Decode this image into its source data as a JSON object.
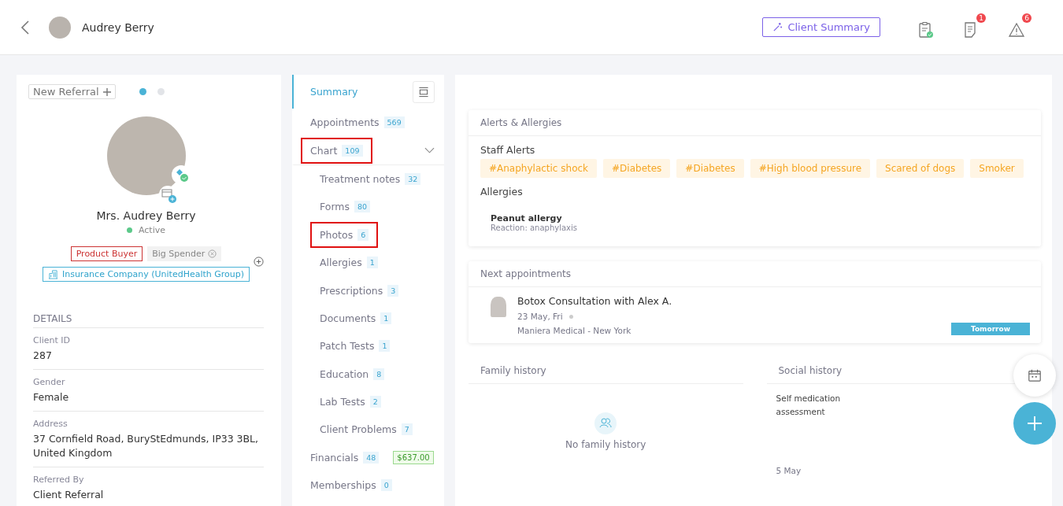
{
  "header": {
    "client_name": "Audrey Berry",
    "summary_button": "Client Summary",
    "notifications": [
      {
        "kind": "clipboard"
      },
      {
        "kind": "notes",
        "badge": "1"
      },
      {
        "kind": "alert",
        "badge": "6"
      }
    ]
  },
  "profile": {
    "referral_button": "New Referral",
    "dots": [
      {
        "selected": true
      },
      {
        "selected": false
      }
    ],
    "name": "Mrs. Audrey Berry",
    "status": "Active",
    "active": true,
    "tags": [
      {
        "label": "Product Buyer",
        "kind": "outlined"
      },
      {
        "label": "Big Spender",
        "kind": "removable"
      }
    ],
    "insurance": "Insurance Company (UnitedHealth Group)",
    "details_title": "DETAILS",
    "details": [
      {
        "label": "Client ID",
        "value": "287"
      },
      {
        "label": "Gender",
        "value": "Female"
      },
      {
        "label": "Address",
        "value": "37 Cornfield Road, BuryStEdmunds, IP33 3BL, United Kingdom"
      },
      {
        "label": "Referred By",
        "value": "Client Referral"
      }
    ]
  },
  "nav": [
    {
      "label": "Summary",
      "selected": true,
      "highlighted": false
    },
    {
      "label": "Appointments",
      "count": "569",
      "selected": false,
      "highlighted": false
    },
    {
      "label": "Chart",
      "count": "109",
      "selected": false,
      "highlighted": true,
      "expanded": true,
      "children": [
        {
          "label": "Treatment notes",
          "count": "32",
          "highlighted": false
        },
        {
          "label": "Forms",
          "count": "80",
          "highlighted": false
        },
        {
          "label": "Photos",
          "count": "6",
          "highlighted": true
        },
        {
          "label": "Allergies",
          "count": "1",
          "highlighted": false
        },
        {
          "label": "Prescriptions",
          "count": "3",
          "highlighted": false
        },
        {
          "label": "Documents",
          "count": "1",
          "highlighted": false
        },
        {
          "label": "Patch Tests",
          "count": "1",
          "highlighted": false
        },
        {
          "label": "Education",
          "count": "8",
          "highlighted": false
        },
        {
          "label": "Lab Tests",
          "count": "2",
          "highlighted": false
        },
        {
          "label": "Client Problems",
          "count": "7",
          "highlighted": false
        }
      ]
    },
    {
      "label": "Financials",
      "count": "48",
      "amount": "$637.00",
      "selected": false,
      "highlighted": false
    },
    {
      "label": "Memberships",
      "count": "0",
      "selected": false,
      "highlighted": false
    }
  ],
  "alerts": {
    "title": "Alerts & Allergies",
    "staff_title": "Staff Alerts",
    "staff_alerts": [
      "#Anaphylactic shock",
      "#Diabetes",
      "#Diabetes",
      "#High blood pressure",
      "Scared of dogs",
      "Smoker"
    ],
    "allergies_title": "Allergies",
    "allergies": [
      {
        "name": "Peanut allergy",
        "reaction": "Reaction: anaphylaxis"
      }
    ]
  },
  "appointments": {
    "title": "Next appointments",
    "items": [
      {
        "title": "Botox Consultation with Alex A.",
        "date": "23 May, Fri",
        "location": "Maniera Medical - New York",
        "badge": "Tomorrow"
      }
    ]
  },
  "family_history": {
    "title": "Family history",
    "empty": "No family history"
  },
  "social_history": {
    "title": "Social history",
    "entries": [
      {
        "text": "Self medication assessment",
        "date": "5 May"
      }
    ]
  }
}
